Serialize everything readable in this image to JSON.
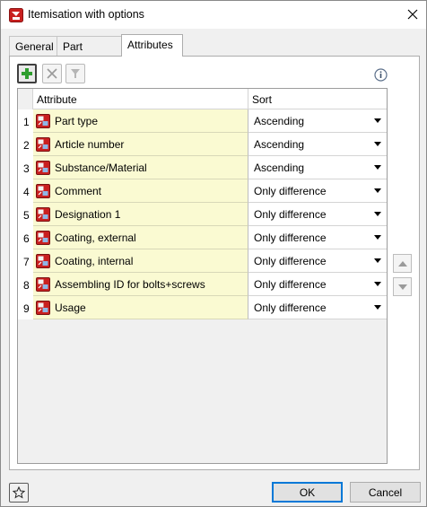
{
  "window": {
    "title": "Itemisation with options"
  },
  "tabs": [
    {
      "label": "General"
    },
    {
      "label": "Part groups"
    },
    {
      "label": "Attributes"
    }
  ],
  "active_tab": "Attributes",
  "toolbar": {
    "add_icon": "add-icon",
    "delete_icon": "delete-icon",
    "filter_icon": "filter-icon",
    "info_icon": "info-icon"
  },
  "grid": {
    "columns": [
      "Attribute",
      "Sort"
    ],
    "rows": [
      {
        "num": "1",
        "attribute": "Part type",
        "sort": "Ascending"
      },
      {
        "num": "2",
        "attribute": "Article number",
        "sort": "Ascending"
      },
      {
        "num": "3",
        "attribute": "Substance/Material",
        "sort": "Ascending"
      },
      {
        "num": "4",
        "attribute": "Comment",
        "sort": "Only difference"
      },
      {
        "num": "5",
        "attribute": "Designation 1",
        "sort": "Only difference"
      },
      {
        "num": "6",
        "attribute": "Coating, external",
        "sort": "Only difference"
      },
      {
        "num": "7",
        "attribute": "Coating, internal",
        "sort": "Only difference"
      },
      {
        "num": "8",
        "attribute": "Assembling ID for bolts+screws",
        "sort": "Only difference"
      },
      {
        "num": "9",
        "attribute": "Usage",
        "sort": "Only difference"
      }
    ]
  },
  "buttons": {
    "ok": "OK",
    "cancel": "Cancel"
  },
  "colors": {
    "attribute_cell": "#fafad2",
    "ok_focus": "#0078d7",
    "add_green": "#2e9e2e"
  }
}
